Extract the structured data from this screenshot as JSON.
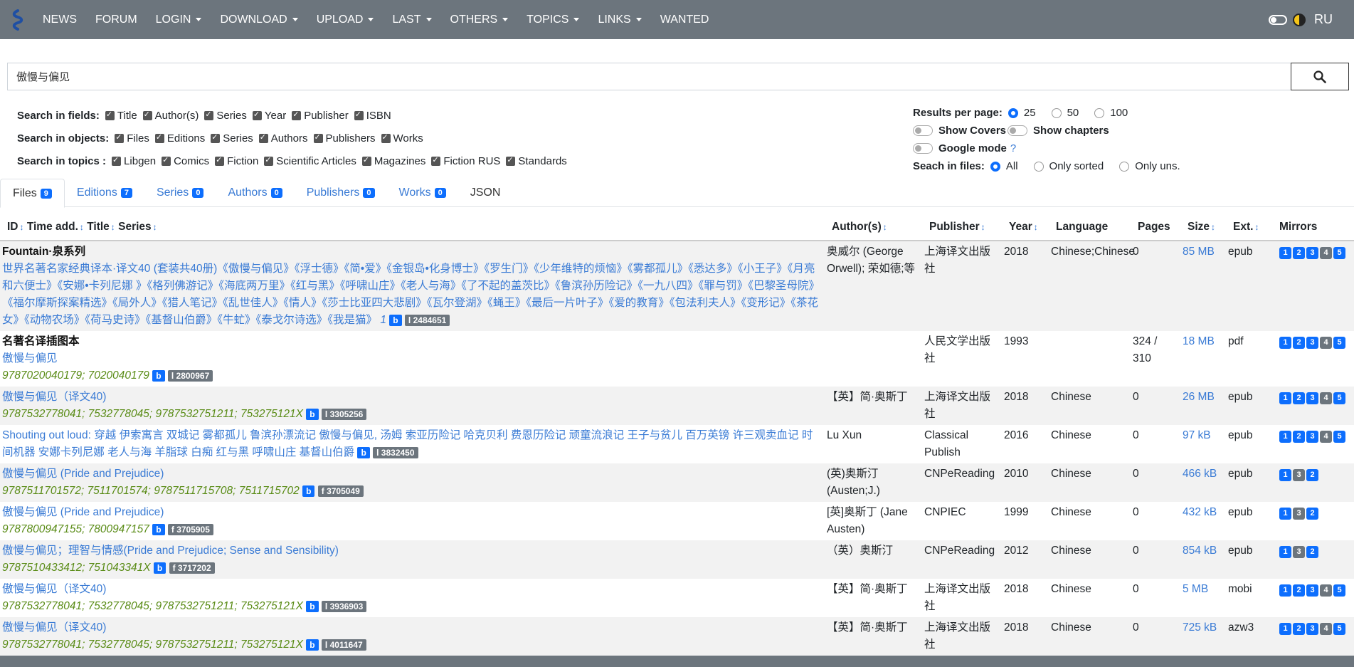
{
  "nav": {
    "items": [
      {
        "label": "NEWS",
        "dropdown": false
      },
      {
        "label": "FORUM",
        "dropdown": false
      },
      {
        "label": "LOGIN",
        "dropdown": true
      },
      {
        "label": "DOWNLOAD",
        "dropdown": true
      },
      {
        "label": "UPLOAD",
        "dropdown": true
      },
      {
        "label": "LAST",
        "dropdown": true
      },
      {
        "label": "OTHERS",
        "dropdown": true
      },
      {
        "label": "TOPICS",
        "dropdown": true
      },
      {
        "label": "LINKS",
        "dropdown": true
      },
      {
        "label": "WANTED",
        "dropdown": false
      }
    ],
    "lang": "RU",
    "bg_color": "#6c757d"
  },
  "search": {
    "value": "傲慢与偏见"
  },
  "fields": {
    "label": "Search in fields:",
    "items": [
      "Title",
      "Author(s)",
      "Series",
      "Year",
      "Publisher",
      "ISBN"
    ]
  },
  "objects": {
    "label": "Search in objects:",
    "items": [
      "Files",
      "Editions",
      "Series",
      "Authors",
      "Publishers",
      "Works"
    ]
  },
  "topics": {
    "label": "Search in topics :",
    "items": [
      "Libgen",
      "Comics",
      "Fiction",
      "Scientific Articles",
      "Magazines",
      "Fiction RUS",
      "Standards"
    ]
  },
  "results": {
    "label": "Results per page:",
    "options": [
      "25",
      "50",
      "100"
    ],
    "selected": "25"
  },
  "show_covers": "Show Covers",
  "show_chapters": "Show chapters",
  "google_mode": "Google mode",
  "google_help": "?",
  "files_search": {
    "label": "Seach in files:",
    "options": [
      "All",
      "Only sorted",
      "Only uns."
    ],
    "selected": "All"
  },
  "tabs": [
    {
      "label": "Files",
      "count": "9"
    },
    {
      "label": "Editions",
      "count": "7"
    },
    {
      "label": "Series",
      "count": "0"
    },
    {
      "label": "Authors",
      "count": "0"
    },
    {
      "label": "Publishers",
      "count": "0"
    },
    {
      "label": "Works",
      "count": "0"
    },
    {
      "label": "JSON",
      "count": ""
    }
  ],
  "columns": {
    "id": "ID",
    "time": "Time add.",
    "title": "Title",
    "series": "Series",
    "author": "Author(s)",
    "publisher": "Publisher",
    "year": "Year",
    "language": "Language",
    "pages": "Pages",
    "size": "Size",
    "ext": "Ext.",
    "mirrors": "Mirrors"
  },
  "rows": [
    {
      "series": "Fountain·泉系列",
      "title": "世界名著名家经典译本·译文40 (套装共40册)《傲慢与偏见》《浮士德》《简•爱》《金银岛•化身博士》《罗生门》《少年维特的烦恼》《雾都孤儿》《悉达多》《小王子》《月亮和六便士》《安娜•卡列尼娜 》《格列佛游记》《海底两万里》《红与黑》《呼啸山庄》《老人与海》《了不起的盖茨比》《鲁滨孙历险记》《一九八四》《罪与罚》《巴黎圣母院》《福尔摩斯探案精选》《局外人》《猎人笔记》《乱世佳人》《情人》《莎士比亚四大悲剧》《瓦尔登湖》《蝇王》《最后一片叶子》《爱的教育》《包法利夫人》《变形记》《茶花女》《动物农场》《荷马史诗》《基督山伯爵》《牛虻》《泰戈尔诗选》《我是猫》",
      "vol": "1",
      "isbn": "",
      "id": "l 2484651",
      "author": "奥威尔 (George Orwell); 荣如德;等",
      "publisher": "上海译文出版社",
      "year": "2018",
      "language": "Chinese;Chinese",
      "pages": "0",
      "size": "85 MB",
      "ext": "epub",
      "mirrors": [
        "1",
        "2",
        "3",
        "4",
        "5"
      ]
    },
    {
      "series": "名著名译插图本",
      "title": "傲慢与偏见",
      "vol": "",
      "isbn": "9787020040179; 7020040179",
      "id": "l 2800967",
      "author": "",
      "publisher": "人民文学出版社",
      "year": "1993",
      "language": "",
      "pages": "324 / 310",
      "size": "18 MB",
      "ext": "pdf",
      "mirrors": [
        "1",
        "2",
        "3",
        "4",
        "5"
      ]
    },
    {
      "series": "",
      "title": "傲慢与偏见（译文40)",
      "vol": "",
      "isbn": "9787532778041; 7532778045; 9787532751211; 753275121X",
      "id": "l 3305256",
      "author": "【英】简·奥斯丁",
      "publisher": "上海译文出版社",
      "year": "2018",
      "language": "Chinese",
      "pages": "0",
      "size": "26 MB",
      "ext": "epub",
      "mirrors": [
        "1",
        "2",
        "3",
        "4",
        "5"
      ]
    },
    {
      "series": "",
      "title": "Shouting out loud: 穿越 伊索寓言 双城记 雾都孤儿 鲁滨孙漂流记 傲慢与偏见, 汤姆 索亚历险记 哈克贝利 费恩历险记 顽童流浪记 王子与贫儿 百万英镑 许三观卖血记 时间机器 安娜卡列尼娜 老人与海 羊脂球 白痴 红与黑 呼啸山庄 基督山伯爵",
      "vol": "",
      "isbn": "",
      "id": "l 3832450",
      "author": "Lu Xun",
      "publisher": "Classical Publish",
      "year": "2016",
      "language": "Chinese",
      "pages": "0",
      "size": "97 kB",
      "ext": "epub",
      "mirrors": [
        "1",
        "2",
        "3",
        "4",
        "5"
      ]
    },
    {
      "series": "",
      "title": "傲慢与偏见 (Pride and Prejudice)",
      "vol": "",
      "isbn": "9787511701572; 7511701574; 9787511715708; 7511715702",
      "id": "f 3705049",
      "author": "(英)奥斯汀(Austen;J.)",
      "publisher": "CNPeReading",
      "year": "2010",
      "language": "Chinese",
      "pages": "0",
      "size": "466 kB",
      "ext": "epub",
      "mirrors": [
        "1",
        "3",
        "2"
      ]
    },
    {
      "series": "",
      "title": "傲慢与偏见 (Pride and Prejudice)",
      "vol": "",
      "isbn": "9787800947155; 7800947157",
      "id": "f 3705905",
      "author": "[英]奥斯丁 (Jane Austen)",
      "publisher": "CNPIEC",
      "year": "1999",
      "language": "Chinese",
      "pages": "0",
      "size": "432 kB",
      "ext": "epub",
      "mirrors": [
        "1",
        "3",
        "2"
      ]
    },
    {
      "series": "",
      "title": "傲慢与偏见；理智与情感(Pride and Prejudice; Sense and Sensibility)",
      "vol": "",
      "isbn": "9787510433412; 751043341X",
      "id": "f 3717202",
      "author": "（英）奥斯汀",
      "publisher": "CNPeReading",
      "year": "2012",
      "language": "Chinese",
      "pages": "0",
      "size": "854 kB",
      "ext": "epub",
      "mirrors": [
        "1",
        "3",
        "2"
      ]
    },
    {
      "series": "",
      "title": "傲慢与偏见（译文40)",
      "vol": "",
      "isbn": "9787532778041; 7532778045; 9787532751211; 753275121X",
      "id": "l 3936903",
      "author": "【英】简·奥斯丁",
      "publisher": "上海译文出版社",
      "year": "2018",
      "language": "Chinese",
      "pages": "0",
      "size": "5 MB",
      "ext": "mobi",
      "mirrors": [
        "1",
        "2",
        "3",
        "4",
        "5"
      ]
    },
    {
      "series": "",
      "title": "傲慢与偏见（译文40)",
      "vol": "",
      "isbn": "9787532778041; 7532778045; 9787532751211; 753275121X",
      "id": "l 4011647",
      "author": "【英】简·奥斯丁",
      "publisher": "上海译文出版社",
      "year": "2018",
      "language": "Chinese",
      "pages": "0",
      "size": "725 kB",
      "ext": "azw3",
      "mirrors": [
        "1",
        "2",
        "3",
        "4",
        "5"
      ]
    }
  ]
}
